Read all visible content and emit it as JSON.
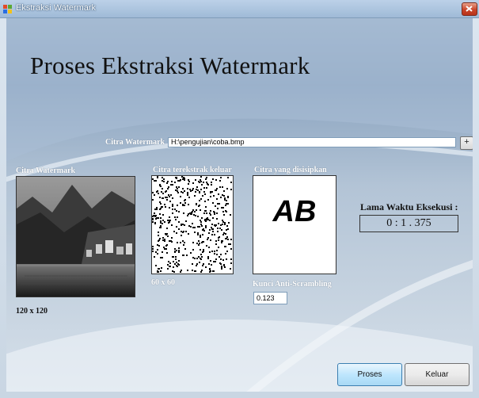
{
  "window": {
    "title": "Ekstraksi Watermark"
  },
  "main": {
    "heading": "Proses Ekstraksi Watermark"
  },
  "watermark_input": {
    "label": "Citra Watermark",
    "value": "H:\\pengujian\\coba.bmp",
    "browse_label": "+"
  },
  "panels": {
    "source_label": "Citra Watermark",
    "source_size": "120 x 120",
    "extracted_label": "Citra terekstrak keluar",
    "extracted_size": "60 x 60",
    "embedded_label": "Citra yang disisipkan",
    "embedded_text": "AB"
  },
  "execution": {
    "label": "Lama Waktu Eksekusi  :",
    "value": "0 : 1 . 375"
  },
  "key": {
    "label": "Kunci Anti-Scrambling",
    "value": "0.123"
  },
  "buttons": {
    "process": "Proses",
    "exit": "Keluar"
  },
  "colors": {
    "accent_button": "#bee6fd",
    "close_button": "#c9452a",
    "background": "#b3c4d6"
  }
}
